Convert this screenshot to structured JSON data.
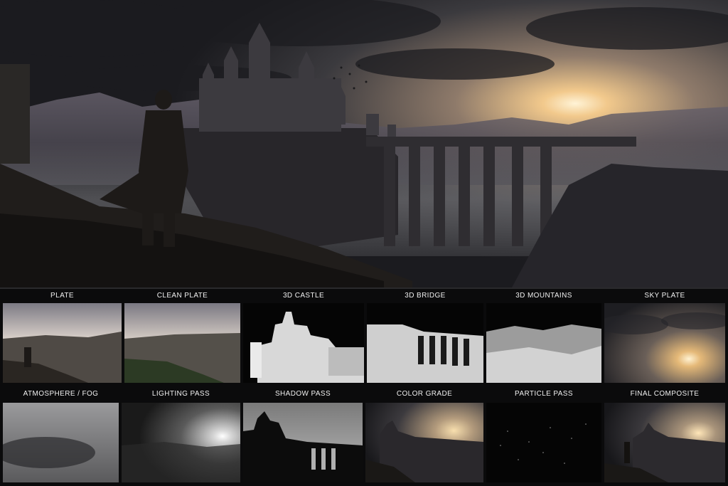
{
  "hero": {
    "icon": "fantasy-castle-bridge-scene"
  },
  "passes": [
    {
      "label": "PLATE",
      "icon": "plate-thumb"
    },
    {
      "label": "CLEAN PLATE",
      "icon": "clean-plate-thumb"
    },
    {
      "label": "3D CASTLE",
      "icon": "castle-depth-thumb"
    },
    {
      "label": "3D BRIDGE",
      "icon": "bridge-depth-thumb"
    },
    {
      "label": "3D MOUNTAINS",
      "icon": "mountains-depth-thumb"
    },
    {
      "label": "SKY PLATE",
      "icon": "sky-plate-thumb"
    },
    {
      "label": "ATMOSPHERE / FOG",
      "icon": "fog-thumb"
    },
    {
      "label": "LIGHTING PASS",
      "icon": "lighting-thumb"
    },
    {
      "label": "SHADOW PASS",
      "icon": "shadow-thumb"
    },
    {
      "label": "COLOR GRADE",
      "icon": "color-grade-thumb"
    },
    {
      "label": "PARTICLE PASS",
      "icon": "particle-thumb"
    },
    {
      "label": "FINAL COMPOSITE",
      "icon": "final-composite-thumb"
    }
  ],
  "colors": {
    "background": "#0b0b0c",
    "sky_glow": "#f3d29a",
    "sky_dark": "#2b2a2e",
    "rock": "#2a2623",
    "depth_light": "#e6e6e6",
    "depth_dark": "#0a0a0a"
  }
}
